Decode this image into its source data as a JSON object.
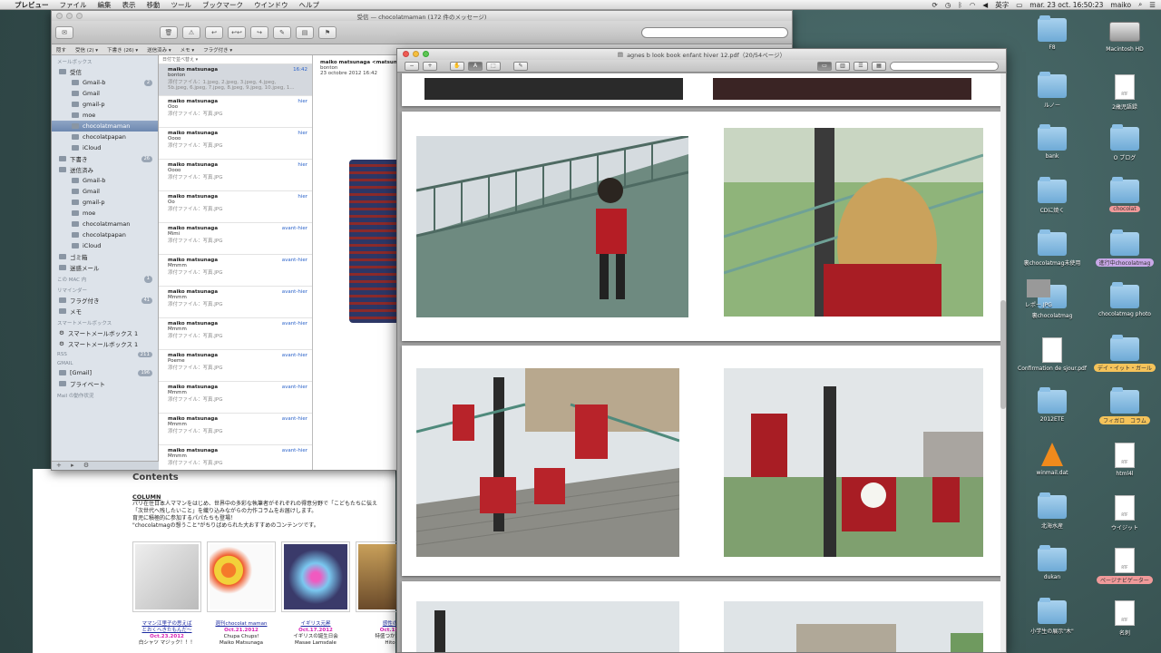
{
  "menubar": {
    "app": "プレビュー",
    "items": [
      "ファイル",
      "編集",
      "表示",
      "移動",
      "ツール",
      "ブックマーク",
      "ウインドウ",
      "ヘルプ"
    ],
    "input_source": "英字",
    "datetime": "mar. 23 oct.  16:50:23",
    "user": "maiko"
  },
  "mail": {
    "title": "受信 — chocolatmaman (172 件のメッセージ)",
    "search_placeholder": "",
    "favorites": [
      "隠す",
      "受信 (2) ▾",
      "下書き (26) ▾",
      "送信済み ▾",
      "メモ ▾",
      "フラグ付き ▾"
    ],
    "sidebar": {
      "section_mailboxes": "メールボックス",
      "inbox": "受信",
      "inbox_accounts": [
        {
          "name": "Gmail-b",
          "count": "2"
        },
        {
          "name": "Gmail",
          "count": ""
        },
        {
          "name": "gmail-p",
          "count": ""
        },
        {
          "name": "moe",
          "count": ""
        },
        {
          "name": "chocolatmaman",
          "count": "",
          "selected": true
        },
        {
          "name": "chocolatpapan",
          "count": ""
        },
        {
          "name": "iCloud",
          "count": ""
        }
      ],
      "drafts": "下書き",
      "drafts_count": "26",
      "sent": "送信済み",
      "sent_accounts": [
        "Gmail-b",
        "Gmail",
        "gmail-p",
        "moe",
        "chocolatmaman",
        "chocolatpapan",
        "iCloud"
      ],
      "trash": "ゴミ箱",
      "junk": "迷惑メール",
      "section_mac": "この MAC 内",
      "mac_count": "1",
      "section_reminders": "リマインダー",
      "flagged": "フラグ付き",
      "flagged_count": "41",
      "notes": "メモ",
      "section_smart": "スマートメールボックス",
      "smart": [
        "スマートメールボックス 1",
        "スマートメールボックス 1"
      ],
      "section_rss": "RSS",
      "rss_count": "211",
      "section_gmail": "GMAIL",
      "gmail_folder": "[Gmail]",
      "gmail_count": "196",
      "private": "プライベート",
      "activity": "Mail の動作状況"
    },
    "sort_label": "日付で並べ替え ▾",
    "messages": [
      {
        "from": "maiko matsunaga",
        "time": "16:42",
        "subject": "bonton",
        "attachment": "添付ファイル：1.jpeg, 2.jpeg, 3.jpeg, 4.jpeg,",
        "attachment2": "5b.jpeg, 6.jpeg, 7.jpeg, 8.jpeg, 9.jpeg, 10.jpeg, 1..."
      },
      {
        "from": "maiko matsunaga",
        "time": "hier",
        "subject": "Ooo",
        "attachment": "添付ファイル：写真.JPG",
        "attachment2": ""
      },
      {
        "from": "maiko matsunaga",
        "time": "hier",
        "subject": "Oooo",
        "attachment": "添付ファイル：写真.JPG",
        "attachment2": ""
      },
      {
        "from": "maiko matsunaga",
        "time": "hier",
        "subject": "Oooo",
        "attachment": "添付ファイル：写真.JPG",
        "attachment2": ""
      },
      {
        "from": "maiko matsunaga",
        "time": "hier",
        "subject": "Oo",
        "attachment": "添付ファイル：写真.JPG",
        "attachment2": ""
      },
      {
        "from": "maiko matsunaga",
        "time": "avant-hier",
        "subject": "Mimi",
        "attachment": "添付ファイル：写真.JPG",
        "attachment2": ""
      },
      {
        "from": "maiko matsunaga",
        "time": "avant-hier",
        "subject": "Mmmm",
        "attachment": "添付ファイル：写真.JPG",
        "attachment2": ""
      },
      {
        "from": "maiko matsunaga",
        "time": "avant-hier",
        "subject": "Mmmm",
        "attachment": "添付ファイル：写真.JPG",
        "attachment2": ""
      },
      {
        "from": "maiko matsunaga",
        "time": "avant-hier",
        "subject": "Mmmm",
        "attachment": "添付ファイル：写真.JPG",
        "attachment2": ""
      },
      {
        "from": "maiko matsunaga",
        "time": "avant-hier",
        "subject": "Poeme",
        "attachment": "添付ファイル：写真.JPG",
        "attachment2": ""
      },
      {
        "from": "maiko matsunaga",
        "time": "avant-hier",
        "subject": "Mmmm",
        "attachment": "添付ファイル：写真.JPG",
        "attachment2": ""
      },
      {
        "from": "maiko matsunaga",
        "time": "avant-hier",
        "subject": "Mmmm",
        "attachment": "添付ファイル：写真.JPG",
        "attachment2": ""
      },
      {
        "from": "maiko matsunaga",
        "time": "avant-hier",
        "subject": "Mmmm",
        "attachment": "添付ファイル：写真.JPG",
        "attachment2": ""
      }
    ],
    "reader": {
      "from": "maiko matsunaga <matsuna",
      "subject": "bonton",
      "date": "23 octobre 2012 16:42"
    }
  },
  "web": {
    "contents_title": "Contents",
    "column_label": "COLUMN",
    "lines": [
      "パリ在住日本人ママンをはじめ、世界中の多彩な執筆者がそれぞれの得意分野で「こどもたちに伝え",
      "「次世代へ残したいこと」を織り込みながらの力作コラムをお届けします。",
      "育児に積極的に参加するパパたちも登場！",
      "\"chocolatmagの想うこと\"がちりばめられた大おすすめのコンテンツです。"
    ],
    "thumbs": [
      {
        "title": "ママン江里子の思えば",
        "title2": "とおくへきたもんだ〜",
        "date": "Oct.23.2012",
        "sub": "白シャツ マジック！！！"
      },
      {
        "title": "週刊chocolat maman",
        "title2": "",
        "date": "Oct.21.2012",
        "sub": "Chupa Chups!"
      },
      {
        "title": "イギリス元昇",
        "title2": "",
        "date": "Oct.17.2012",
        "sub": "イギリスの誕生日会"
      },
      {
        "title": "感性の",
        "title2": "",
        "date": "Oct.15.",
        "sub": "特盛つかだく"
      }
    ],
    "authors": [
      "",
      "Maiko Matsunaga",
      "Masae Lamsdale",
      "Hito"
    ]
  },
  "preview": {
    "title": "agnes b look book enfant hiver 12.pdf（20/54ページ）",
    "search_placeholder": ""
  },
  "desktop": {
    "items": [
      {
        "label": "F8",
        "kind": "folder",
        "tag": ""
      },
      {
        "label": "Macintosh HD",
        "kind": "hdd",
        "tag": ""
      },
      {
        "label": "ルノー",
        "kind": "folder",
        "tag": ""
      },
      {
        "label": "2歳児語録",
        "kind": "doc",
        "tag": ""
      },
      {
        "label": "bank",
        "kind": "folder",
        "tag": ""
      },
      {
        "label": "O ブログ",
        "kind": "folder",
        "tag": ""
      },
      {
        "label": "CDに焼く",
        "kind": "folder",
        "tag": ""
      },
      {
        "label": "chocolat",
        "kind": "folder",
        "tag": "#f09a9a"
      },
      {
        "label": "裏chocolatmag未使用",
        "kind": "folder",
        "tag": ""
      },
      {
        "label": "進行中chocolatmag",
        "kind": "folder",
        "tag": "#c9a8e8"
      },
      {
        "label": "裏chocolatmag",
        "kind": "folder",
        "tag": ""
      },
      {
        "label": "chocolatmag photo",
        "kind": "folder",
        "tag": ""
      },
      {
        "label": "Confirmation de sjour.pdf",
        "kind": "pdf",
        "tag": ""
      },
      {
        "label": "デイ・イット・ガール",
        "kind": "folder",
        "tag": "#f5c35a"
      },
      {
        "label": "2012ETE",
        "kind": "folder",
        "tag": ""
      },
      {
        "label": "フィガロ　コラム",
        "kind": "folder",
        "tag": "#f5c35a"
      },
      {
        "label": "winmail.dat",
        "kind": "vlc",
        "tag": ""
      },
      {
        "label": "html4l",
        "kind": "doc",
        "tag": ""
      },
      {
        "label": "北海水産",
        "kind": "folder",
        "tag": ""
      },
      {
        "label": "ウイジット",
        "kind": "doc",
        "tag": ""
      },
      {
        "label": "dukan",
        "kind": "folder",
        "tag": ""
      },
      {
        "label": "ページナビゲーター",
        "kind": "doc",
        "tag": "#f09a9a"
      },
      {
        "label": "小学生の展示\"木\"",
        "kind": "folder",
        "tag": ""
      },
      {
        "label": "名刺",
        "kind": "doc",
        "tag": ""
      },
      {
        "label": "レポー.JPG",
        "kind": "partial",
        "tag": ""
      }
    ]
  },
  "colors": {
    "desktop": "#3d5b5b",
    "mail_link": "#2a62c9",
    "web_date": "#d61fb4"
  }
}
